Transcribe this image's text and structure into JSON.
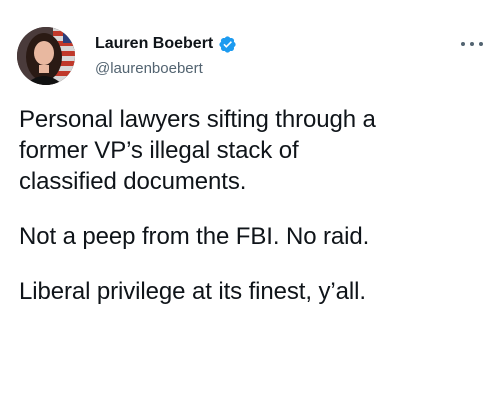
{
  "author": {
    "display_name": "Lauren Boebert",
    "handle": "@laurenboebert",
    "verified": true
  },
  "tweet": {
    "paragraphs": [
      "Personal lawyers sifting through a\nformer VP’s illegal stack of\nclassified documents.",
      "Not a peep from the FBI. No raid.",
      "Liberal privilege at its finest, y’all."
    ]
  },
  "icons": {
    "verified": "verified-badge-icon",
    "more": "more-options-icon"
  },
  "colors": {
    "verified_blue": "#1d9bf0",
    "text": "#0f1419",
    "muted": "#536471"
  }
}
